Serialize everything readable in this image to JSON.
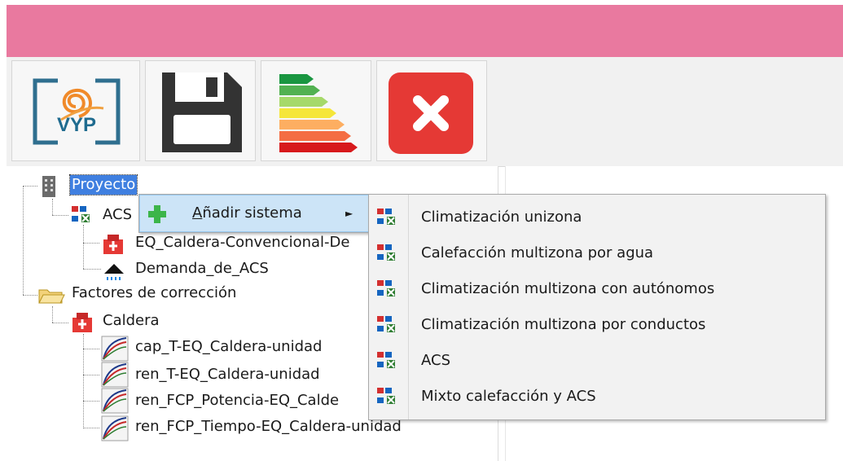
{
  "toolbar": {
    "logo_text": "VYP",
    "buttons": [
      "logo-icon",
      "save-icon",
      "energy-rating-icon",
      "close-icon"
    ]
  },
  "tree": {
    "root": "Proyecto",
    "acs": "ACS",
    "equipo": "EQ_Caldera-Convencional-De",
    "demanda": "Demanda_de_ACS",
    "factores": "Factores de corrección",
    "caldera": "Caldera",
    "curves": [
      "cap_T-EQ_Caldera-unidad",
      "ren_T-EQ_Caldera-unidad",
      "ren_FCP_Potencia-EQ_Calde",
      "ren_FCP_Tiempo-EQ_Caldera-unidad"
    ]
  },
  "context_menu": {
    "item_prefix": "A",
    "item_rest": "ñadir sistema",
    "arrow": "►"
  },
  "submenu": {
    "items": [
      "Climatización unizona",
      "Calefacción multizona por agua",
      "Climatización multizona con autónomos",
      "Climatización multizona por conductos",
      "ACS",
      "Mixto calefacción y ACS"
    ]
  },
  "colors": {
    "titlebar": "#e9799f",
    "selection": "#3f7fe0",
    "close_button": "#e53935"
  }
}
